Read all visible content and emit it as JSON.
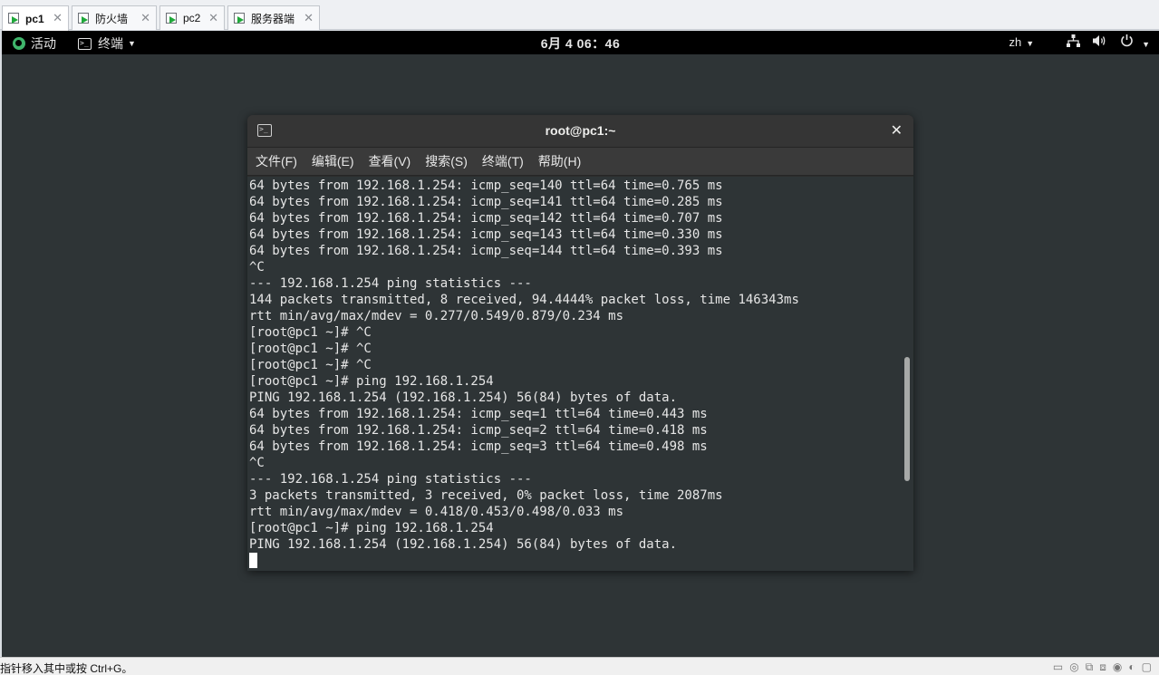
{
  "tabs": [
    {
      "label": "pc1",
      "active": true
    },
    {
      "label": "防火墙",
      "active": false
    },
    {
      "label": "pc2",
      "active": false
    },
    {
      "label": "服务器端",
      "active": false
    }
  ],
  "tab_close_glyph": "✕",
  "topbar": {
    "activities": "活动",
    "app_menu": "终端",
    "clock": "6月 4 06：46",
    "lang": "zh",
    "icons": [
      "network-icon",
      "volume-icon",
      "power-icon"
    ]
  },
  "terminal": {
    "title": "root@pc1:~",
    "menu": [
      "文件(F)",
      "编辑(E)",
      "查看(V)",
      "搜索(S)",
      "终端(T)",
      "帮助(H)"
    ],
    "lines": [
      "64 bytes from 192.168.1.254: icmp_seq=140 ttl=64 time=0.765 ms",
      "64 bytes from 192.168.1.254: icmp_seq=141 ttl=64 time=0.285 ms",
      "64 bytes from 192.168.1.254: icmp_seq=142 ttl=64 time=0.707 ms",
      "64 bytes from 192.168.1.254: icmp_seq=143 ttl=64 time=0.330 ms",
      "64 bytes from 192.168.1.254: icmp_seq=144 ttl=64 time=0.393 ms",
      "^C",
      "--- 192.168.1.254 ping statistics ---",
      "144 packets transmitted, 8 received, 94.4444% packet loss, time 146343ms",
      "rtt min/avg/max/mdev = 0.277/0.549/0.879/0.234 ms",
      "[root@pc1 ~]# ^C",
      "[root@pc1 ~]# ^C",
      "[root@pc1 ~]# ^C",
      "[root@pc1 ~]# ping 192.168.1.254",
      "PING 192.168.1.254 (192.168.1.254) 56(84) bytes of data.",
      "64 bytes from 192.168.1.254: icmp_seq=1 ttl=64 time=0.443 ms",
      "64 bytes from 192.168.1.254: icmp_seq=2 ttl=64 time=0.418 ms",
      "64 bytes from 192.168.1.254: icmp_seq=3 ttl=64 time=0.498 ms",
      "^C",
      "--- 192.168.1.254 ping statistics ---",
      "3 packets transmitted, 3 received, 0% packet loss, time 2087ms",
      "rtt min/avg/max/mdev = 0.418/0.453/0.498/0.033 ms",
      "[root@pc1 ~]# ping 192.168.1.254",
      "PING 192.168.1.254 (192.168.1.254) 56(84) bytes of data."
    ],
    "scroll_position": 0.67
  },
  "statusbar": {
    "text": "指针移入其中或按 Ctrl+G。"
  }
}
